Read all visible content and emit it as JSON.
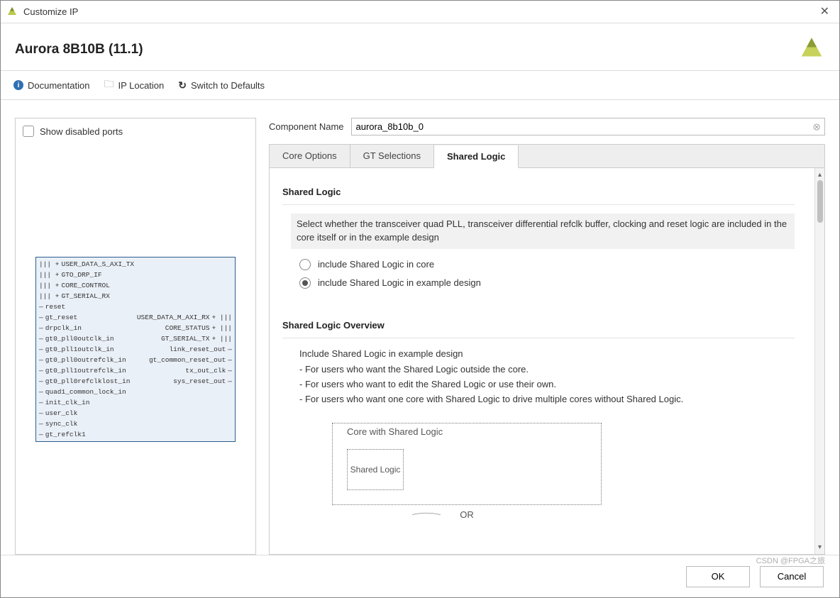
{
  "window": {
    "title": "Customize IP"
  },
  "header": {
    "title": "Aurora 8B10B (11.1)"
  },
  "toolbar": {
    "documentation": "Documentation",
    "ip_location": "IP Location",
    "switch_defaults": "Switch to Defaults"
  },
  "preview": {
    "show_disabled_ports_label": "Show disabled ports",
    "show_disabled_ports_checked": false,
    "ports_left": [
      {
        "name": "USER_DATA_S_AXI_TX",
        "bus": true,
        "expandable": true
      },
      {
        "name": "GTO_DRP_IF",
        "bus": true,
        "expandable": true
      },
      {
        "name": "CORE_CONTROL",
        "bus": true,
        "expandable": true
      },
      {
        "name": "GT_SERIAL_RX",
        "bus": true,
        "expandable": true
      },
      {
        "name": "reset",
        "bus": false,
        "expandable": false
      },
      {
        "name": "gt_reset",
        "bus": false,
        "expandable": false
      },
      {
        "name": "drpclk_in",
        "bus": false,
        "expandable": false
      },
      {
        "name": "gt0_pll0outclk_in",
        "bus": false,
        "expandable": false
      },
      {
        "name": "gt0_pll1outclk_in",
        "bus": false,
        "expandable": false
      },
      {
        "name": "gt0_pll0outrefclk_in",
        "bus": false,
        "expandable": false
      },
      {
        "name": "gt0_pll1outrefclk_in",
        "bus": false,
        "expandable": false
      },
      {
        "name": "gt0_pll0refclklost_in",
        "bus": false,
        "expandable": false
      },
      {
        "name": "quad1_common_lock_in",
        "bus": false,
        "expandable": false
      },
      {
        "name": "init_clk_in",
        "bus": false,
        "expandable": false
      },
      {
        "name": "user_clk",
        "bus": false,
        "expandable": false
      },
      {
        "name": "sync_clk",
        "bus": false,
        "expandable": false
      },
      {
        "name": "gt_refclk1",
        "bus": false,
        "expandable": false
      }
    ],
    "ports_right": [
      {
        "row": 5,
        "name": "USER_DATA_M_AXI_RX",
        "bus": true,
        "expandable": true
      },
      {
        "row": 6,
        "name": "CORE_STATUS",
        "bus": true,
        "expandable": true
      },
      {
        "row": 7,
        "name": "GT_SERIAL_TX",
        "bus": true,
        "expandable": true
      },
      {
        "row": 8,
        "name": "link_reset_out",
        "bus": false,
        "expandable": false
      },
      {
        "row": 9,
        "name": "gt_common_reset_out",
        "bus": false,
        "expandable": false
      },
      {
        "row": 10,
        "name": "tx_out_clk",
        "bus": false,
        "expandable": false
      },
      {
        "row": 11,
        "name": "sys_reset_out",
        "bus": false,
        "expandable": false
      }
    ]
  },
  "config": {
    "component_name_label": "Component Name",
    "component_name_value": "aurora_8b10b_0",
    "tabs": [
      {
        "id": "core_options",
        "label": "Core Options",
        "active": false
      },
      {
        "id": "gt_selections",
        "label": "GT Selections",
        "active": false
      },
      {
        "id": "shared_logic",
        "label": "Shared Logic",
        "active": true
      }
    ],
    "shared_logic": {
      "section_title": "Shared Logic",
      "description": "Select whether the transceiver quad PLL, transceiver differential refclk buffer, clocking and reset logic are included in the core itself or in the example design",
      "options": [
        {
          "label": "include Shared Logic in core",
          "selected": false
        },
        {
          "label": "include Shared Logic in example design",
          "selected": true
        }
      ],
      "overview_title": "Shared Logic Overview",
      "overview_lead": "Include Shared Logic in example design",
      "overview_bullets": [
        "- For users who want the Shared Logic outside the core.",
        "- For users who want to edit the Shared Logic or use their own.",
        "- For users who want one core with Shared Logic to drive multiple cores without Shared Logic."
      ],
      "diagram": {
        "outer_label": "Core with Shared Logic",
        "inner_label": "Shared Logic",
        "or_label": "OR"
      }
    }
  },
  "footer": {
    "ok": "OK",
    "cancel": "Cancel"
  },
  "watermark": "CSDN @FPGA之旅"
}
